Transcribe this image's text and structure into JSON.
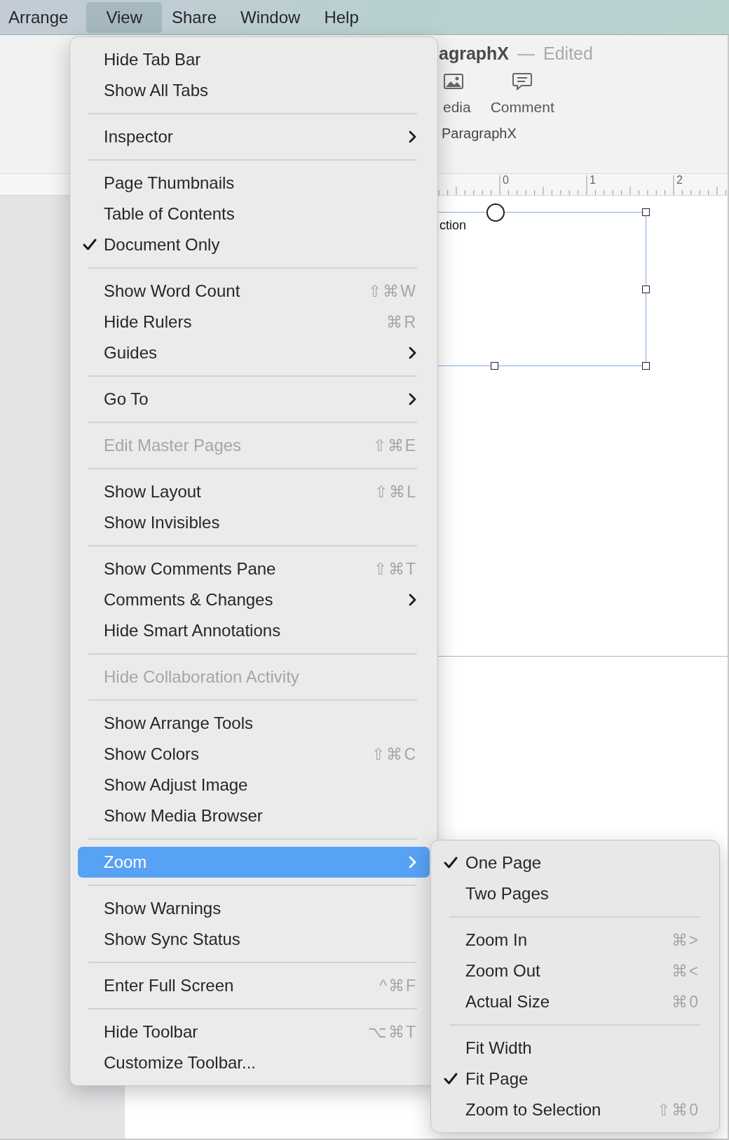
{
  "menu_bar": [
    {
      "label": "Arrange",
      "selected": false
    },
    {
      "label": "View",
      "selected": true
    },
    {
      "label": "Share",
      "selected": false
    },
    {
      "label": "Window",
      "selected": false
    },
    {
      "label": "Help",
      "selected": false
    }
  ],
  "toolbar": {
    "title": "agraphX",
    "separator": "—",
    "status": "Edited",
    "buttons": [
      {
        "kind": "media",
        "label": "edia"
      },
      {
        "kind": "comment",
        "label": "Comment"
      }
    ],
    "tab": "ParagraphX"
  },
  "ruler": [
    "0",
    "1",
    "2"
  ],
  "document": {
    "text": "ction"
  },
  "view_menu": [
    [
      {
        "label": "Hide Tab Bar",
        "checked": false,
        "disabled": false,
        "submenu": false,
        "selected": false
      },
      {
        "label": "Show All Tabs",
        "checked": false,
        "disabled": false,
        "submenu": false,
        "selected": false
      }
    ],
    [
      {
        "label": "Inspector",
        "checked": false,
        "disabled": false,
        "submenu": true,
        "selected": false
      }
    ],
    [
      {
        "label": "Page Thumbnails",
        "checked": false,
        "disabled": false,
        "submenu": false,
        "selected": false
      },
      {
        "label": "Table of Contents",
        "checked": false,
        "disabled": false,
        "submenu": false,
        "selected": false
      },
      {
        "label": "Document Only",
        "checked": true,
        "disabled": false,
        "submenu": false,
        "selected": false
      }
    ],
    [
      {
        "label": "Show Word Count",
        "shortcut": "⇧⌘W",
        "checked": false,
        "disabled": false,
        "submenu": false,
        "selected": false
      },
      {
        "label": "Hide Rulers",
        "shortcut": "⌘R",
        "checked": false,
        "disabled": false,
        "submenu": false,
        "selected": false
      },
      {
        "label": "Guides",
        "checked": false,
        "disabled": false,
        "submenu": true,
        "selected": false
      }
    ],
    [
      {
        "label": "Go To",
        "checked": false,
        "disabled": false,
        "submenu": true,
        "selected": false
      }
    ],
    [
      {
        "label": "Edit Master Pages",
        "shortcut": "⇧⌘E",
        "checked": false,
        "disabled": true,
        "submenu": false,
        "selected": false
      }
    ],
    [
      {
        "label": "Show Layout",
        "shortcut": "⇧⌘L",
        "checked": false,
        "disabled": false,
        "submenu": false,
        "selected": false
      },
      {
        "label": "Show Invisibles",
        "checked": false,
        "disabled": false,
        "submenu": false,
        "selected": false
      }
    ],
    [
      {
        "label": "Show Comments Pane",
        "shortcut": "⇧⌘T",
        "checked": false,
        "disabled": false,
        "submenu": false,
        "selected": false
      },
      {
        "label": "Comments & Changes",
        "checked": false,
        "disabled": false,
        "submenu": true,
        "selected": false
      },
      {
        "label": "Hide Smart Annotations",
        "checked": false,
        "disabled": false,
        "submenu": false,
        "selected": false
      }
    ],
    [
      {
        "label": "Hide Collaboration Activity",
        "checked": false,
        "disabled": true,
        "submenu": false,
        "selected": false
      }
    ],
    [
      {
        "label": "Show Arrange Tools",
        "checked": false,
        "disabled": false,
        "submenu": false,
        "selected": false
      },
      {
        "label": "Show Colors",
        "shortcut": "⇧⌘C",
        "checked": false,
        "disabled": false,
        "submenu": false,
        "selected": false
      },
      {
        "label": "Show Adjust Image",
        "checked": false,
        "disabled": false,
        "submenu": false,
        "selected": false
      },
      {
        "label": "Show Media Browser",
        "checked": false,
        "disabled": false,
        "submenu": false,
        "selected": false
      }
    ],
    [
      {
        "label": "Zoom",
        "checked": false,
        "disabled": false,
        "submenu": true,
        "selected": true
      }
    ],
    [
      {
        "label": "Show Warnings",
        "checked": false,
        "disabled": false,
        "submenu": false,
        "selected": false
      },
      {
        "label": "Show Sync Status",
        "checked": false,
        "disabled": false,
        "submenu": false,
        "selected": false
      }
    ],
    [
      {
        "label": "Enter Full Screen",
        "shortcut": "^⌘F",
        "checked": false,
        "disabled": false,
        "submenu": false,
        "selected": false
      }
    ],
    [
      {
        "label": "Hide Toolbar",
        "shortcut": "⌥⌘T",
        "checked": false,
        "disabled": false,
        "submenu": false,
        "selected": false
      },
      {
        "label": "Customize Toolbar...",
        "checked": false,
        "disabled": false,
        "submenu": false,
        "selected": false
      }
    ]
  ],
  "zoom_menu": [
    [
      {
        "label": "One Page",
        "checked": true
      },
      {
        "label": "Two Pages",
        "checked": false
      }
    ],
    [
      {
        "label": "Zoom In",
        "shortcut": "⌘>",
        "checked": false
      },
      {
        "label": "Zoom Out",
        "shortcut": "⌘<",
        "checked": false
      },
      {
        "label": "Actual Size",
        "shortcut": "⌘0",
        "checked": false
      }
    ],
    [
      {
        "label": "Fit Width",
        "checked": false
      },
      {
        "label": "Fit Page",
        "checked": true
      },
      {
        "label": "Zoom to Selection",
        "shortcut": "⇧⌘0",
        "checked": false
      }
    ]
  ]
}
